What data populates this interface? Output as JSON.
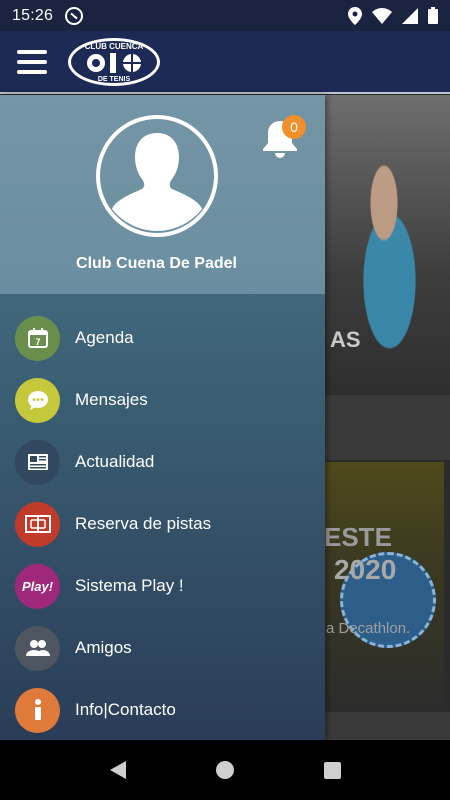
{
  "status_bar": {
    "time": "15:26"
  },
  "header": {
    "logo": {
      "top_text": "CLUB CUENCA",
      "bottom_text": "DE TENIS"
    }
  },
  "background": {
    "hero_text": "AS",
    "card_text_1": "ESTE",
    "card_text_2": "2020",
    "card_text_3": "a Decathlon."
  },
  "drawer": {
    "profile_name": "Club Cuena De Padel",
    "notification_count": "0",
    "items": [
      {
        "label": "Agenda",
        "icon": "calendar-icon",
        "color": "#6a8f4c"
      },
      {
        "label": "Mensajes",
        "icon": "chat-bubble-icon",
        "color": "#c5c83a"
      },
      {
        "label": "Actualidad",
        "icon": "newspaper-icon",
        "color": "#32485e"
      },
      {
        "label": "Reserva de pistas",
        "icon": "court-icon",
        "color": "#c23b2a"
      },
      {
        "label": "Sistema Play !",
        "icon": "play-icon",
        "color": "#a0287a",
        "icon_text": "Play!"
      },
      {
        "label": "Amigos",
        "icon": "friends-icon",
        "color": "#4e5661"
      },
      {
        "label": "Info|Contacto",
        "icon": "info-icon",
        "color": "#e07a3a"
      }
    ]
  }
}
